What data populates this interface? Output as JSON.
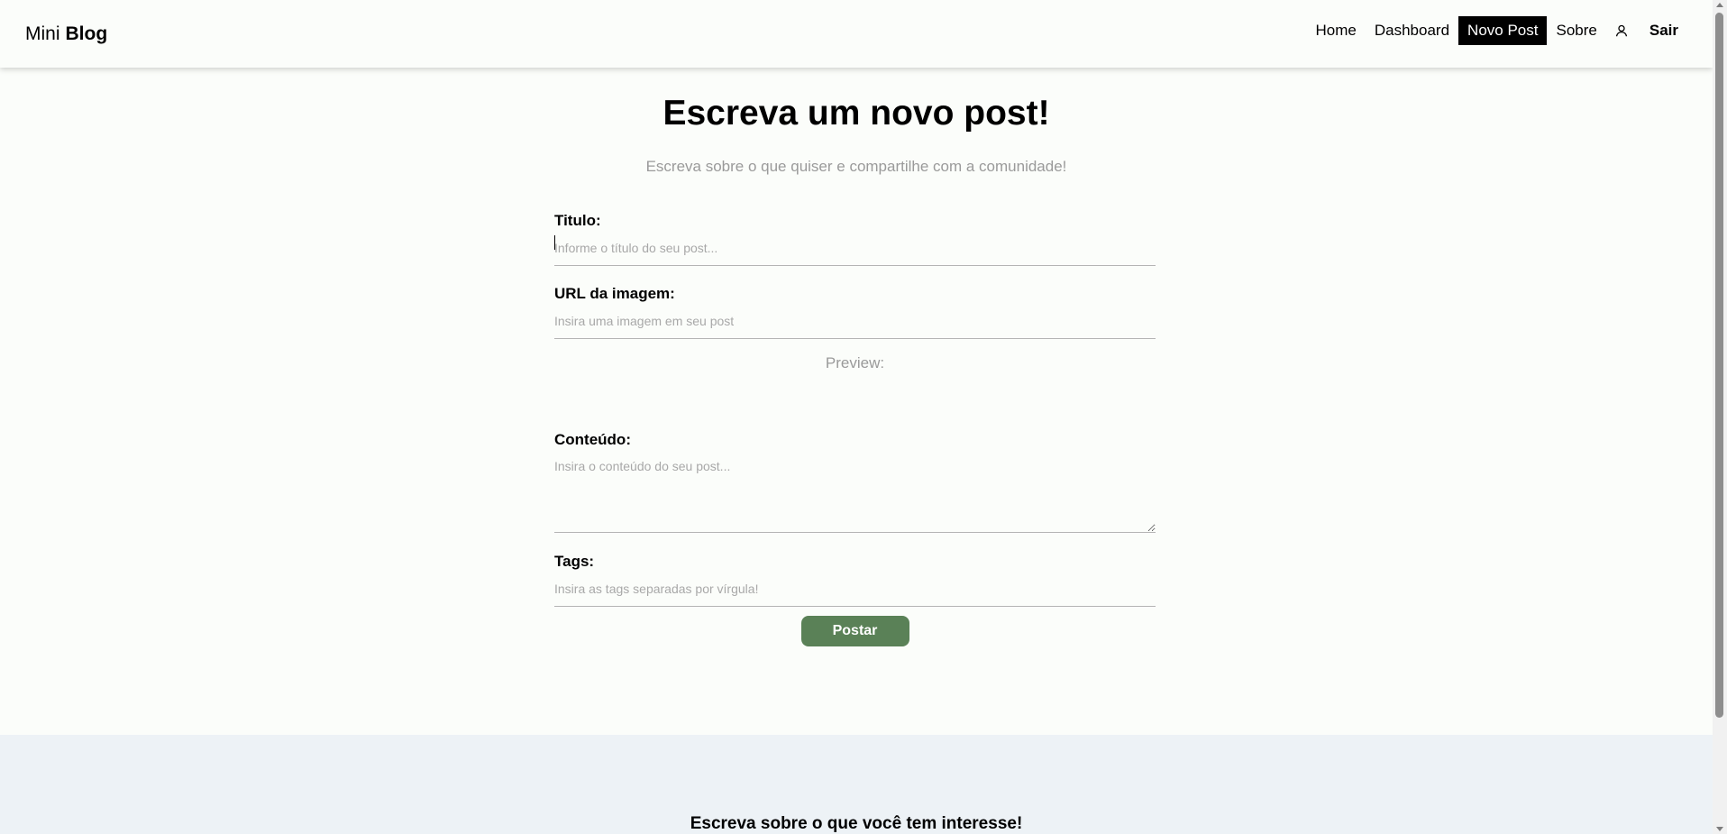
{
  "brand": {
    "first": "Mini",
    "second": "Blog"
  },
  "nav": {
    "items": [
      {
        "label": "Home",
        "active": false
      },
      {
        "label": "Dashboard",
        "active": false
      },
      {
        "label": "Novo Post",
        "active": true
      },
      {
        "label": "Sobre",
        "active": false
      }
    ],
    "user_icon": "user-icon",
    "logout_label": "Sair"
  },
  "page": {
    "title": "Escreva um novo post!",
    "subtitle": "Escreva sobre o que quiser e compartilhe com a comunidade!"
  },
  "form": {
    "title_label": "Titulo:",
    "title_placeholder": "Informe o título do seu post...",
    "title_value": "",
    "image_label": "URL da imagem:",
    "image_placeholder": "Insira uma imagem em seu post",
    "image_value": "",
    "preview_label": "Preview:",
    "content_label": "Conteúdo:",
    "content_placeholder": "Insira o conteúdo do seu post...",
    "content_value": "",
    "tags_label": "Tags:",
    "tags_placeholder": "Insira as tags separadas por vírgula!",
    "tags_value": "",
    "submit_label": "Postar"
  },
  "footer": {
    "title": "Escreva sobre o que você tem interesse!"
  },
  "colors": {
    "accent_button": "#5a8157",
    "active_nav": "#000000",
    "footer_bg": "#edf2f6"
  }
}
